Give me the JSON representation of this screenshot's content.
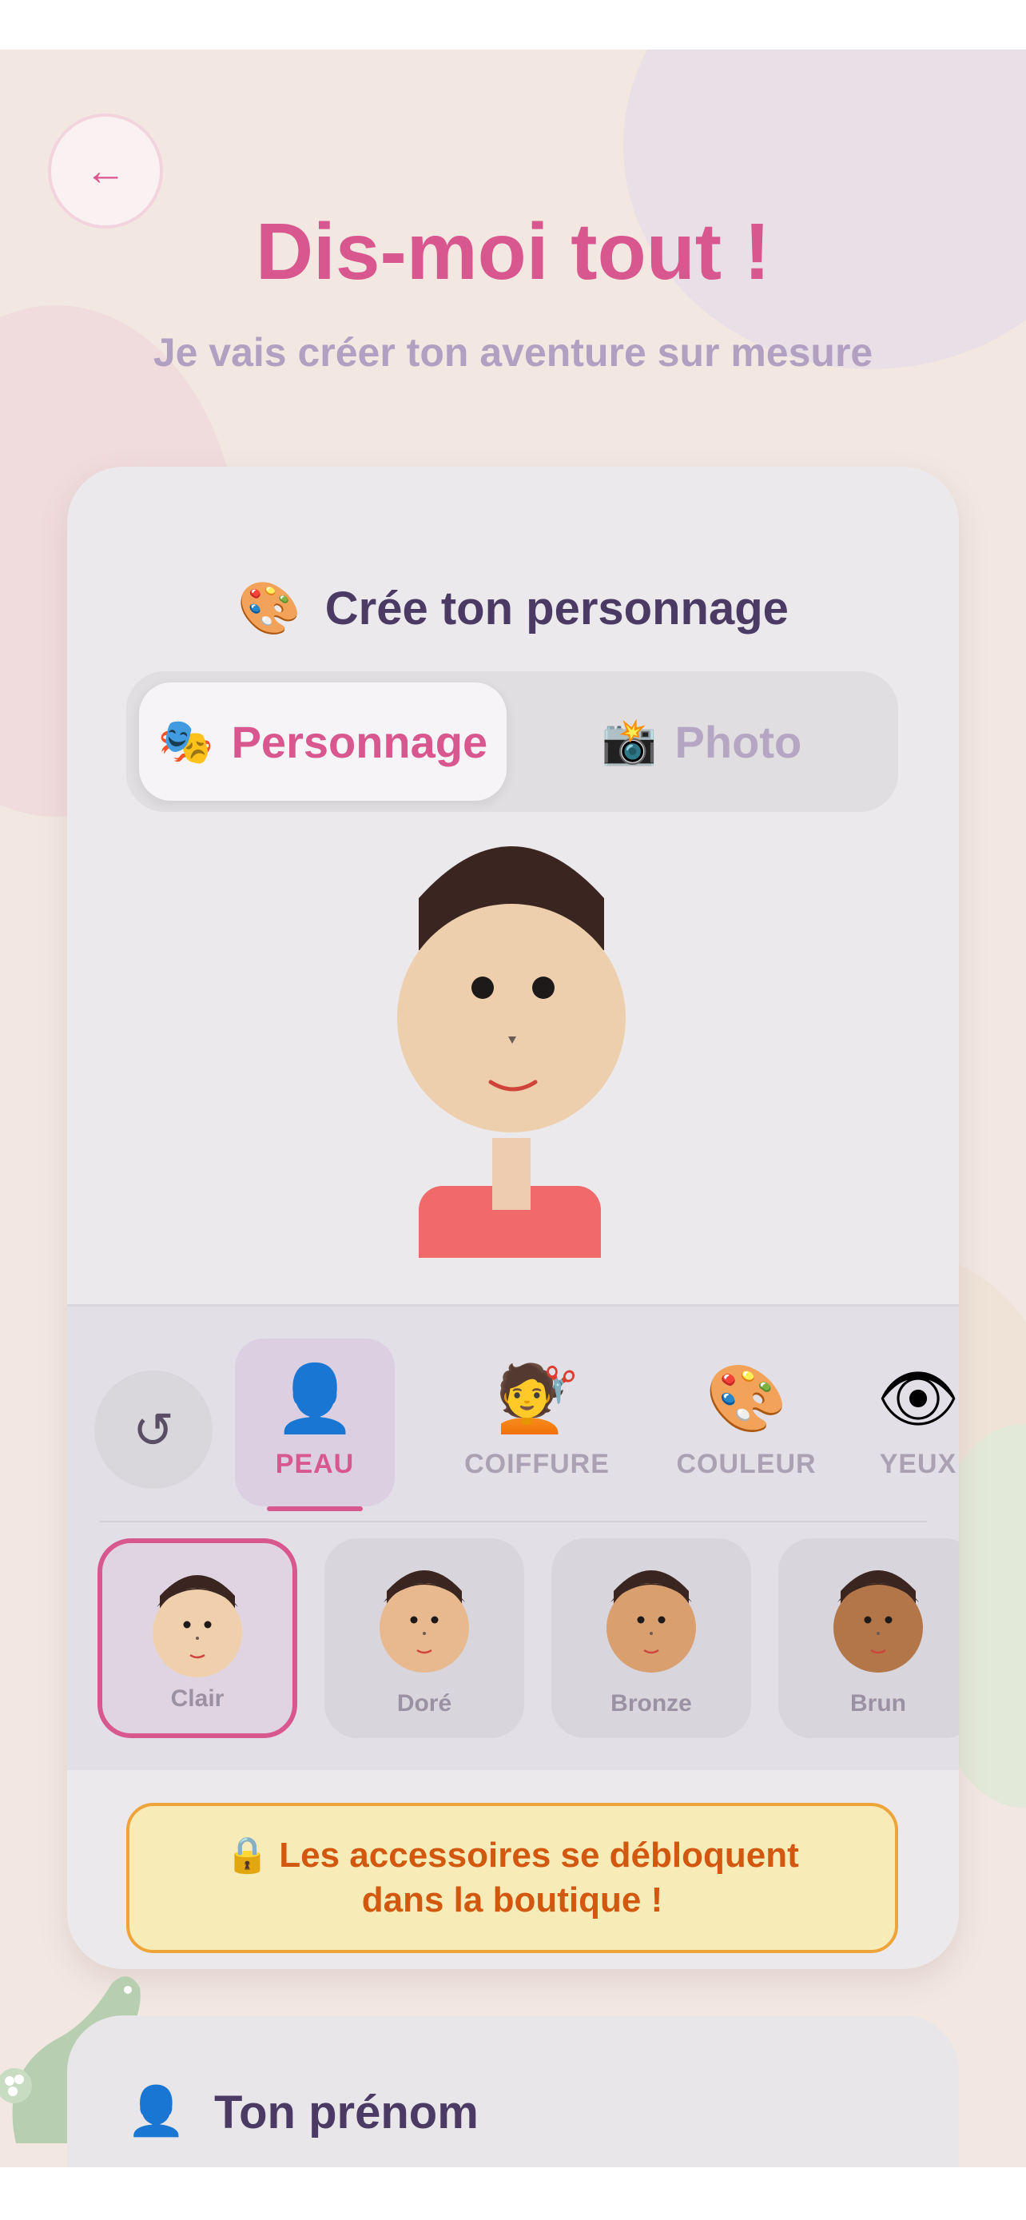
{
  "header": {
    "back_icon": "←",
    "title": "Dis-moi tout !",
    "subtitle": "Je vais créer ton aventure sur mesure"
  },
  "card": {
    "title_icon": "🎨",
    "title": "Crée ton personnage",
    "modes": [
      {
        "icon": "🎭",
        "label": "Personnage",
        "active": true
      },
      {
        "icon": "📸",
        "label": "Photo",
        "active": false
      }
    ]
  },
  "editor": {
    "reset_icon": "↺",
    "categories": [
      {
        "icon": "👤",
        "label": "PEAU",
        "active": true
      },
      {
        "icon": "💇",
        "label": "COIFFURE",
        "active": false
      },
      {
        "icon": "🎨",
        "label": "COULEUR",
        "active": false
      },
      {
        "icon": "👁",
        "label": "YEUX",
        "active": false
      }
    ],
    "skin_options": [
      {
        "label": "Clair",
        "color": "#f0cfad",
        "selected": true
      },
      {
        "label": "Doré",
        "color": "#e8b98e",
        "selected": false
      },
      {
        "label": "Bronze",
        "color": "#d99f6e",
        "selected": false
      },
      {
        "label": "Brun",
        "color": "#b27648",
        "selected": false
      }
    ]
  },
  "lock_banner": {
    "icon": "🔒",
    "line1": "Les accessoires se débloquent",
    "line2": "dans la boutique !"
  },
  "name_section": {
    "icon": "👤",
    "label": "Ton prénom"
  },
  "colors": {
    "accent": "#d9578f",
    "subtitle": "#b2a0c2",
    "dark_text": "#4a3a64",
    "warning": "#d2580f",
    "warning_border": "#efa43a",
    "shirt": "#f06a6c",
    "hair": "#3a2520"
  }
}
